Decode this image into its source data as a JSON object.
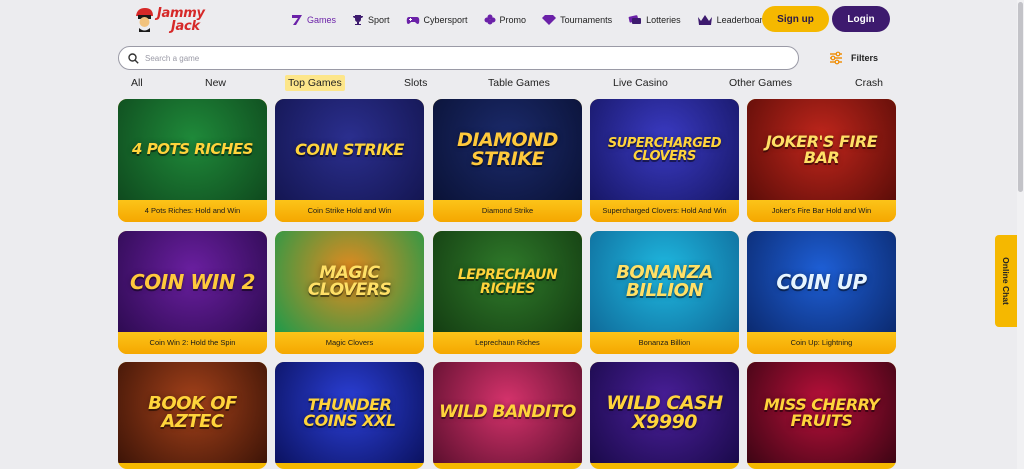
{
  "brand": {
    "line1": "Jammy",
    "line2": "Jack",
    "color": "#d62828"
  },
  "nav": [
    {
      "label": "Games",
      "icon": "seven-icon",
      "active": true
    },
    {
      "label": "Sport",
      "icon": "trophy-icon",
      "active": false
    },
    {
      "label": "Cybersport",
      "icon": "gamepad-icon",
      "active": false
    },
    {
      "label": "Promo",
      "icon": "clover-icon",
      "active": false
    },
    {
      "label": "Tournaments",
      "icon": "diamond-icon",
      "active": false
    },
    {
      "label": "Lotteries",
      "icon": "tickets-icon",
      "active": false
    },
    {
      "label": "Leaderboard",
      "icon": "crown-icon",
      "active": false
    }
  ],
  "auth": {
    "signup": "Sign up",
    "login": "Login"
  },
  "search": {
    "placeholder": "Search a game",
    "value": ""
  },
  "filters": {
    "label": "Filters"
  },
  "categories": [
    {
      "label": "All",
      "active": false
    },
    {
      "label": "New",
      "active": false
    },
    {
      "label": "Top Games",
      "active": true
    },
    {
      "label": "Slots",
      "active": false
    },
    {
      "label": "Table Games",
      "active": false
    },
    {
      "label": "Live Casino",
      "active": false
    },
    {
      "label": "Other Games",
      "active": false
    },
    {
      "label": "Crash",
      "active": false
    }
  ],
  "games": [
    {
      "caption": "4 Pots Riches: Hold and Win",
      "art": "4 POTS RICHES",
      "bg": "#1f8a3a",
      "bg2": "#0f4a1e",
      "fg": "#ffd43b"
    },
    {
      "caption": "Coin Strike Hold and Win",
      "art": "COIN STRIKE",
      "bg": "#2b2f8f",
      "bg2": "#141652",
      "fg": "#ffd43b"
    },
    {
      "caption": "Diamond Strike",
      "art": "DIAMOND STRIKE",
      "bg": "#1b2a6b",
      "bg2": "#0a1236",
      "fg": "#ffc93c"
    },
    {
      "caption": "Supercharged Clovers: Hold And Win",
      "art": "SUPERCHARGED CLOVERS",
      "bg": "#3a3ac2",
      "bg2": "#171766",
      "fg": "#ffd43b"
    },
    {
      "caption": "Joker's Fire Bar Hold and Win",
      "art": "JOKER'S FIRE BAR",
      "bg": "#c0261c",
      "bg2": "#5c0d08",
      "fg": "#ffe066"
    },
    {
      "caption": "Coin Win 2: Hold the Spin",
      "art": "COIN WIN 2",
      "bg": "#6a1fa0",
      "bg2": "#2e0b52",
      "fg": "#ffc93c"
    },
    {
      "caption": "Magic Clovers",
      "art": "MAGIC CLOVERS",
      "bg": "#e58a1f",
      "bg2": "#1e9a4a",
      "fg": "#ffe066"
    },
    {
      "caption": "Leprechaun Riches",
      "art": "LEPRECHAUN RICHES",
      "bg": "#2f7a2a",
      "bg2": "#143d12",
      "fg": "#ffd43b"
    },
    {
      "caption": "Bonanza Billion",
      "art": "BONANZA BILLION",
      "bg": "#1fb8e0",
      "bg2": "#0f6b9a",
      "fg": "#ffe066"
    },
    {
      "caption": "Coin Up: Lightning",
      "art": "COIN UP",
      "bg": "#1e5fd6",
      "bg2": "#0b2a70",
      "fg": "#e7f5ff"
    },
    {
      "caption": "",
      "art": "BOOK OF AZTEC",
      "bg": "#a3411a",
      "bg2": "#3d1407",
      "fg": "#ffd43b"
    },
    {
      "caption": "",
      "art": "THUNDER COINS XXL",
      "bg": "#2b3fd6",
      "bg2": "#0b1260",
      "fg": "#ffd43b"
    },
    {
      "caption": "",
      "art": "WILD BANDITO",
      "bg": "#d6336c",
      "bg2": "#5c0f2e",
      "fg": "#ffd43b"
    },
    {
      "caption": "",
      "art": "WILD CASH X9990",
      "bg": "#4a1f9a",
      "bg2": "#1a0a4a",
      "fg": "#ffd43b"
    },
    {
      "caption": "",
      "art": "MISS CHERRY FRUITS",
      "bg": "#b8103a",
      "bg2": "#3d0514",
      "fg": "#ffd43b"
    }
  ],
  "side_chat": {
    "label": "Online Chat"
  },
  "colors": {
    "accent": "#6b21a8",
    "yellow": "#f5b800",
    "login": "#3d1a6e"
  }
}
